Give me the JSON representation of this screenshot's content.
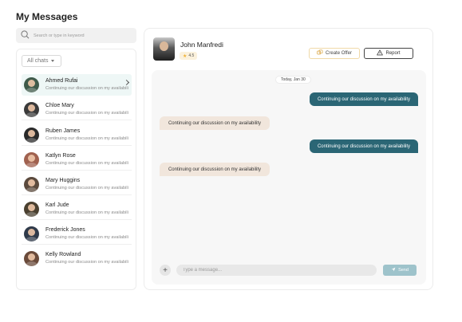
{
  "page": {
    "title": "My Messages"
  },
  "search": {
    "placeholder": "Search or type in keyword"
  },
  "filter": {
    "label": "All chats"
  },
  "chats": [
    {
      "name": "Ahmed Rufai",
      "preview": "Continuing our discussion on my availability",
      "active": true,
      "avatar_color": "#3f5a4a"
    },
    {
      "name": "Chloe Mary",
      "preview": "Continuing our discussion on my availability",
      "active": false,
      "avatar_color": "#3a3a3a"
    },
    {
      "name": "Ruben James",
      "preview": "Continuing our discussion on my availability",
      "active": false,
      "avatar_color": "#2a2a2a"
    },
    {
      "name": "Katlyn Rose",
      "preview": "Continuing our discussion on my availability",
      "active": false,
      "avatar_color": "#a0614f"
    },
    {
      "name": "Mary Huggins",
      "preview": "Continuing our discussion on my availability",
      "active": false,
      "avatar_color": "#5b4a3d"
    },
    {
      "name": "Karl Jude",
      "preview": "Continuing our discussion on my availability",
      "active": false,
      "avatar_color": "#4a4030"
    },
    {
      "name": "Frederick Jones",
      "preview": "Continuing our discussion on my availability",
      "active": false,
      "avatar_color": "#2f3a4a"
    },
    {
      "name": "Kelly Rowland",
      "preview": "Continuing our discussion on my availability",
      "active": false,
      "avatar_color": "#6a4a3a"
    }
  ],
  "conversation": {
    "contact_name": "John Manfredi",
    "rating": "4.5",
    "create_offer_label": "Create Offer",
    "report_label": "Report",
    "date_label": "Today, Jan 30",
    "messages": [
      {
        "direction": "out",
        "text": "Continuing our discussion on my availability"
      },
      {
        "direction": "in",
        "text": "Continuing our discussion on my availability"
      },
      {
        "direction": "out",
        "text": "Continuing our discussion on my availability"
      },
      {
        "direction": "in",
        "text": "Continuing our discussion on my availability"
      }
    ],
    "composer_placeholder": "Type a message...",
    "send_label": "Send"
  },
  "colors": {
    "outgoing_bubble": "#2b6675",
    "incoming_bubble": "#f1e6dc",
    "active_chat_bg": "#eef7f6",
    "send_button": "#9ec3cb",
    "rating_star": "#f0b132"
  },
  "icons": {
    "search": "search-icon",
    "filter_caret": "caret-down-icon",
    "chevron": "chevron-right-icon",
    "offer": "offer-icon",
    "report": "warning-icon",
    "add": "plus-icon",
    "send": "send-icon"
  }
}
